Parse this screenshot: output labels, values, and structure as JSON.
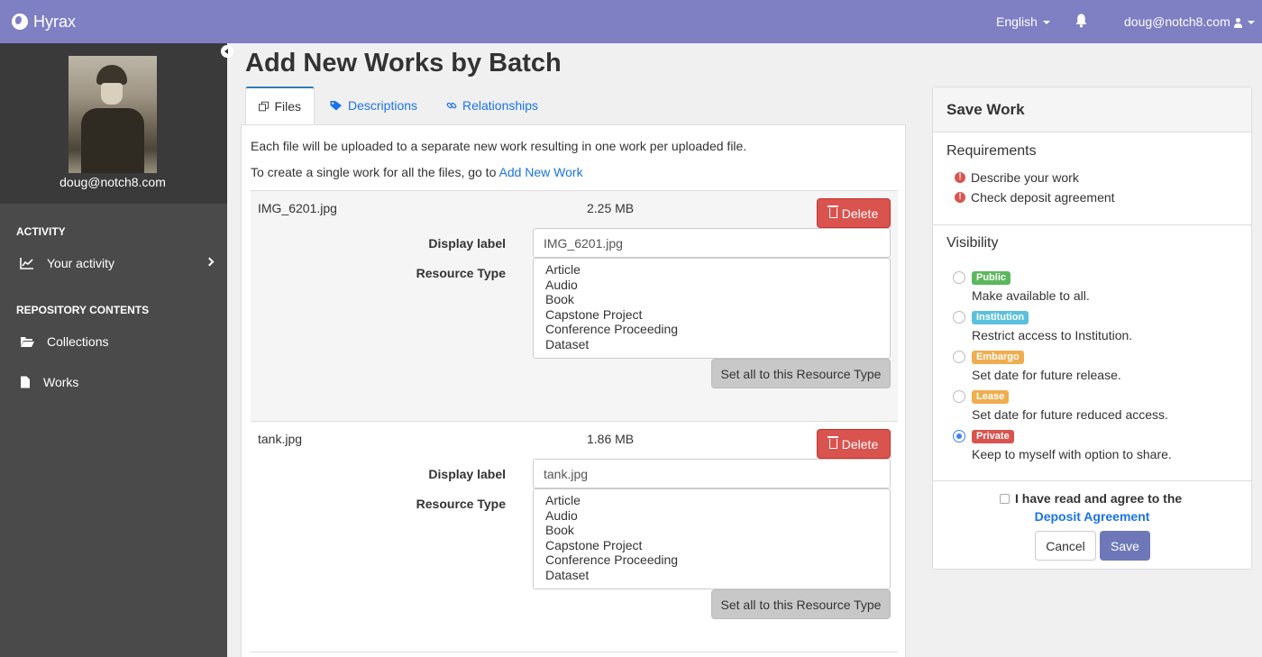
{
  "brand": {
    "name": "Hyrax"
  },
  "topnav": {
    "language": "English",
    "user": "doug@notch8.com"
  },
  "sidebar": {
    "profile_name": "doug@notch8.com",
    "activity_heading": "ACTIVITY",
    "your_activity": "Your activity",
    "repo_heading": "REPOSITORY CONTENTS",
    "collections": "Collections",
    "works": "Works"
  },
  "page": {
    "title": "Add New Works by Batch"
  },
  "tabs": [
    {
      "label": "Files",
      "icon": "files-icon"
    },
    {
      "label": "Descriptions",
      "icon": "tag-icon"
    },
    {
      "label": "Relationships",
      "icon": "link-icon"
    }
  ],
  "files_panel": {
    "intro1": "Each file will be uploaded to a separate new work resulting in one work per uploaded file.",
    "intro2_prefix": "To create a single work for all the files, go to ",
    "intro2_link": "Add New Work",
    "delete_label": "Delete",
    "display_label": "Display label",
    "resource_type_label": "Resource Type",
    "set_all_label": "Set all to this Resource Type",
    "resource_types": [
      "Article",
      "Audio",
      "Book",
      "Capstone Project",
      "Conference Proceeding",
      "Dataset"
    ],
    "files": [
      {
        "name": "IMG_6201.jpg",
        "size": "2.25 MB",
        "display_label": "IMG_6201.jpg"
      },
      {
        "name": "tank.jpg",
        "size": "1.86 MB",
        "display_label": "tank.jpg"
      }
    ]
  },
  "save_work": {
    "title": "Save Work",
    "requirements_title": "Requirements",
    "requirements": [
      "Describe your work",
      "Check deposit agreement"
    ],
    "visibility_title": "Visibility",
    "visibility": [
      {
        "badge": "Public",
        "desc": "Make available to all.",
        "color": "#5cb85c",
        "checked": false
      },
      {
        "badge": "Institution",
        "desc": "Restrict access to Institution.",
        "color": "#5bc0de",
        "checked": false
      },
      {
        "badge": "Embargo",
        "desc": "Set date for future release.",
        "color": "#f0ad4e",
        "checked": false
      },
      {
        "badge": "Lease",
        "desc": "Set date for future reduced access.",
        "color": "#f0ad4e",
        "checked": false
      },
      {
        "badge": "Private",
        "desc": "Keep to myself with option to share.",
        "color": "#d9534f",
        "checked": true
      }
    ],
    "agree_text": "I have read and agree to the",
    "agree_link": "Deposit Agreement",
    "cancel": "Cancel",
    "save": "Save"
  },
  "colors": {
    "topbar": "#7f7fc4",
    "sidebar": "#4a4a4a",
    "link": "#1a73e8",
    "danger": "#d9534f",
    "save": "#6e78b8"
  }
}
